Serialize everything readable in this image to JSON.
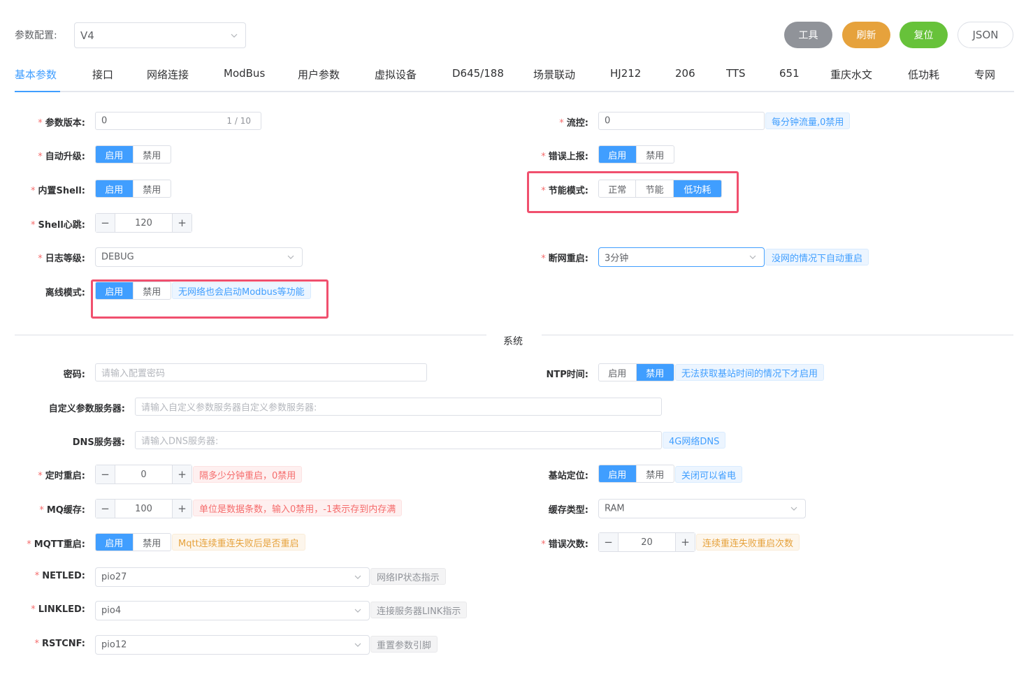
{
  "header": {
    "config_label": "参数配置:",
    "config_value": "V4",
    "buttons": {
      "tool": "工具",
      "refresh": "刷新",
      "reset": "复位",
      "json": "JSON"
    }
  },
  "tabs": [
    "基本参数",
    "接口",
    "网络连接",
    "ModBus",
    "用户参数",
    "虚拟设备",
    "D645/188",
    "场景联动",
    "HJ212",
    "206",
    "TTS",
    "651",
    "重庆水文",
    "低功耗",
    "专网"
  ],
  "colors": {
    "primary": "#409eff",
    "tool_btn": "#909399",
    "refresh_btn": "#e6a23c",
    "reset_btn": "#67c23a",
    "highlight": "#f0506e"
  },
  "form": {
    "param_version": {
      "label": "参数版本:",
      "value": "0",
      "counter": "1 / 10"
    },
    "flow_control": {
      "label": "流控:",
      "value": "0",
      "hint": "每分钟流量,0禁用"
    },
    "auto_upgrade": {
      "label": "自动升级:",
      "options": [
        "启用",
        "禁用"
      ],
      "selected": "启用"
    },
    "error_report": {
      "label": "错误上报:",
      "options": [
        "启用",
        "禁用"
      ],
      "selected": "启用"
    },
    "builtin_shell": {
      "label": "内置Shell:",
      "options": [
        "启用",
        "禁用"
      ],
      "selected": "启用"
    },
    "power_mode": {
      "label": "节能模式:",
      "options": [
        "正常",
        "节能",
        "低功耗"
      ],
      "selected": "低功耗"
    },
    "shell_heartbeat": {
      "label": "Shell心跳:",
      "value": "120",
      "minus": "−",
      "plus": "+"
    },
    "log_level": {
      "label": "日志等级:",
      "value": "DEBUG"
    },
    "offline_restart": {
      "label": "断网重启:",
      "value": "3分钟",
      "hint": "没网的情况下自动重启"
    },
    "offline_mode": {
      "label": "离线模式:",
      "options": [
        "启用",
        "禁用"
      ],
      "selected": "启用",
      "hint": "无网络也会启动Modbus等功能"
    }
  },
  "system": {
    "title": "系统",
    "password": {
      "label": "密码:",
      "placeholder": "请输入配置密码"
    },
    "ntp_time": {
      "label": "NTP时间:",
      "options": [
        "启用",
        "禁用"
      ],
      "selected": "禁用",
      "hint": "无法获取基站时间的情况下才启用"
    },
    "custom_server": {
      "label": "自定义参数服务器:",
      "placeholder": "请输入自定义参数服务器自定义参数服务器:"
    },
    "dns_server": {
      "label": "DNS服务器:",
      "placeholder": "请输入DNS服务器:",
      "hint": "4G网络DNS"
    },
    "timed_restart": {
      "label": "定时重启:",
      "value": "0",
      "hint": "隔多少分钟重启，0禁用"
    },
    "base_station": {
      "label": "基站定位:",
      "options": [
        "启用",
        "禁用"
      ],
      "selected": "启用",
      "hint": "关闭可以省电"
    },
    "mq_cache": {
      "label": "MQ缓存:",
      "value": "100",
      "hint": "单位是数据条数，输入0禁用，-1表示存到内存满"
    },
    "cache_type": {
      "label": "缓存类型:",
      "value": "RAM"
    },
    "mqtt_restart": {
      "label": "MQTT重启:",
      "options": [
        "启用",
        "禁用"
      ],
      "selected": "启用",
      "hint": "Mqtt连续重连失败后是否重启"
    },
    "error_count": {
      "label": "错误次数:",
      "value": "20",
      "hint": "连续重连失败重启次数"
    },
    "netled": {
      "label": "NETLED:",
      "value": "pio27",
      "hint": "网络IP状态指示"
    },
    "linkled": {
      "label": "LINKLED:",
      "value": "pio4",
      "hint": "连接服务器LINK指示"
    },
    "rstcnf": {
      "label": "RSTCNF:",
      "value": "pio12",
      "hint": "重置参数引脚"
    }
  },
  "required_mark": "*"
}
